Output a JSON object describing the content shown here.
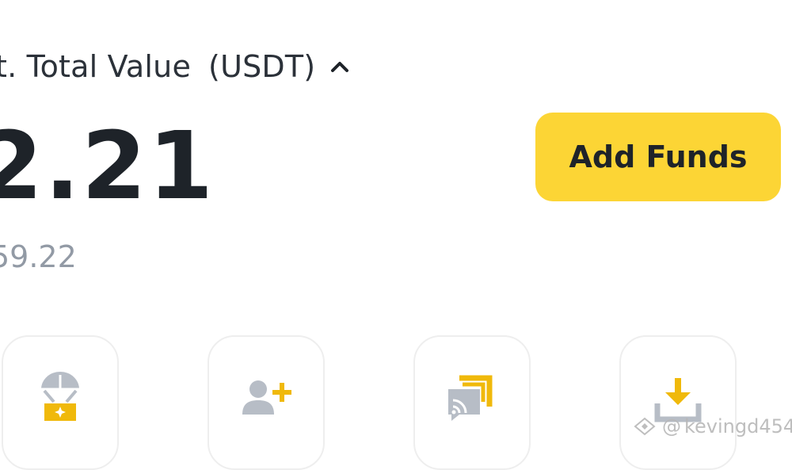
{
  "balance": {
    "label": "t. Total Value",
    "unit": "(USDT)",
    "value": "2.21",
    "fiat": "59.22"
  },
  "actions": {
    "add_funds_label": "Add Funds"
  },
  "tiles": [
    {
      "icon": "parachute-gift-icon"
    },
    {
      "icon": "add-user-icon"
    },
    {
      "icon": "broadcast-icon"
    },
    {
      "icon": "deposit-icon"
    }
  ],
  "watermark": {
    "at": "@",
    "handle": "kevingd454"
  },
  "colors": {
    "brand_yellow": "#FCD535",
    "icon_gray": "#B7BDC6",
    "icon_yellow": "#F0B90B",
    "text_dark": "#1E2329",
    "text_muted": "#929AA5"
  }
}
